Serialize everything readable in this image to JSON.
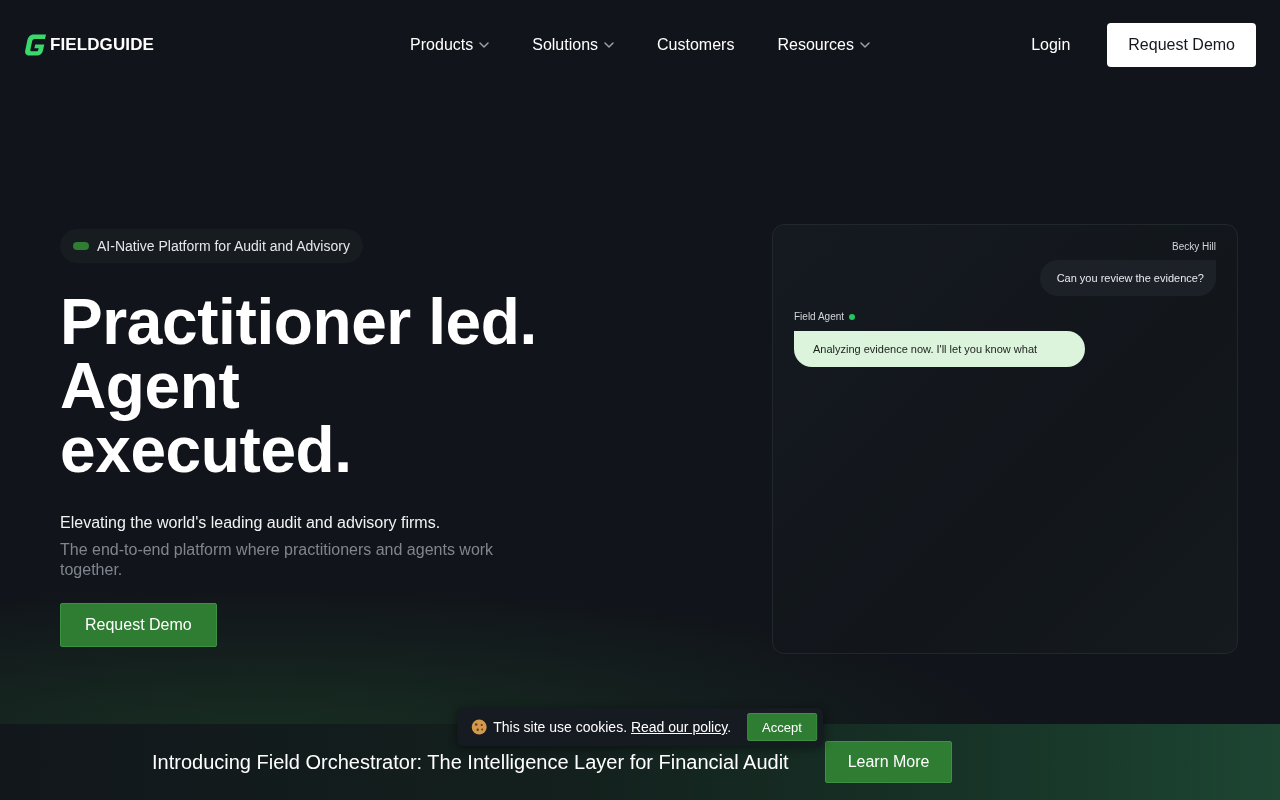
{
  "nav": {
    "brand": "FIELDGUIDE",
    "links": [
      {
        "label": "Products",
        "has_menu": true
      },
      {
        "label": "Solutions",
        "has_menu": true
      },
      {
        "label": "Customers",
        "has_menu": false
      },
      {
        "label": "Resources",
        "has_menu": true
      }
    ],
    "login": "Login",
    "cta": "Request Demo"
  },
  "hero": {
    "tagline": "AI-Native Platform for Audit and Advisory",
    "headline": [
      "Practitioner led.",
      "Agent",
      "executed."
    ],
    "subtitle": "Elevating the world's leading audit and advisory firms.",
    "description": "The end-to-end platform where practitioners and agents work together.",
    "cta": "Request Demo"
  },
  "chat": {
    "messages": [
      {
        "kind": "user",
        "sender": "Becky Hill",
        "text": "Can you review the evidence?"
      },
      {
        "kind": "agent",
        "sender": "Field Agent",
        "text": "Analyzing evidence now. I'll let you know what"
      }
    ]
  },
  "announcement": {
    "text": "Introducing Field Orchestrator: The Intelligence Layer for Financial Audit",
    "button": "Learn More"
  },
  "cookie_notice": {
    "message": "This site use cookies.",
    "link": "Read our policy",
    "after_link": ".",
    "button": "Accept"
  }
}
